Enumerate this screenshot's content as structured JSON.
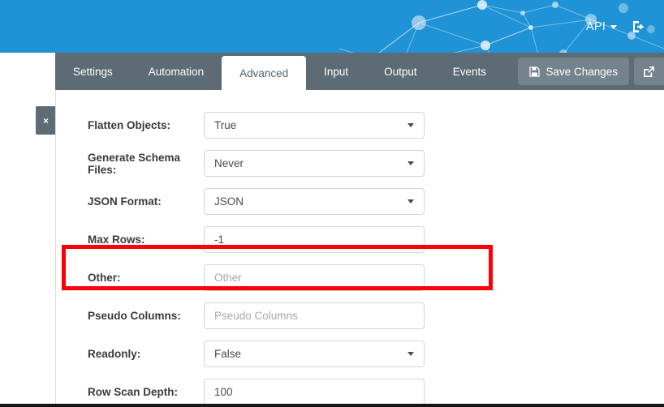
{
  "banner": {
    "api_menu_label": "API",
    "api_menu_caret_icon": "chevron-down-icon",
    "logout_icon": "logout-icon",
    "background_color": "#1f93d5",
    "graphic": "network-constellation-graphic"
  },
  "tabs": {
    "items": [
      {
        "label": "Settings",
        "active": false
      },
      {
        "label": "Automation",
        "active": false
      },
      {
        "label": "Advanced",
        "active": true
      },
      {
        "label": "Input",
        "active": false
      },
      {
        "label": "Output",
        "active": false
      },
      {
        "label": "Events",
        "active": false
      }
    ],
    "bar_color": "#5d6b75",
    "active_tab_color": "#ffffff"
  },
  "toolbar": {
    "save_label": "Save Changes",
    "save_icon": "floppy-disk-icon",
    "popout_icon": "external-link-icon",
    "button_color": "#75838d"
  },
  "collapse_handle": {
    "label": "×",
    "icon": "close-icon"
  },
  "form": {
    "fields": [
      {
        "label": "Flatten Objects:",
        "type": "select",
        "value": "True",
        "is_placeholder": false
      },
      {
        "label": "Generate Schema Files:",
        "type": "select",
        "value": "Never",
        "is_placeholder": false
      },
      {
        "label": "JSON Format:",
        "type": "select",
        "value": "JSON",
        "is_placeholder": false
      },
      {
        "label": "Max Rows:",
        "type": "text",
        "value": "-1",
        "is_placeholder": false
      },
      {
        "label": "Other:",
        "type": "text",
        "value": "Other",
        "is_placeholder": true
      },
      {
        "label": "Pseudo Columns:",
        "type": "text",
        "value": "Pseudo Columns",
        "is_placeholder": true
      },
      {
        "label": "Readonly:",
        "type": "select",
        "value": "False",
        "is_placeholder": false
      },
      {
        "label": "Row Scan Depth:",
        "type": "text",
        "value": "100",
        "is_placeholder": false
      }
    ]
  },
  "annotation": {
    "target_field_label": "Other:",
    "color": "#fb0007"
  }
}
